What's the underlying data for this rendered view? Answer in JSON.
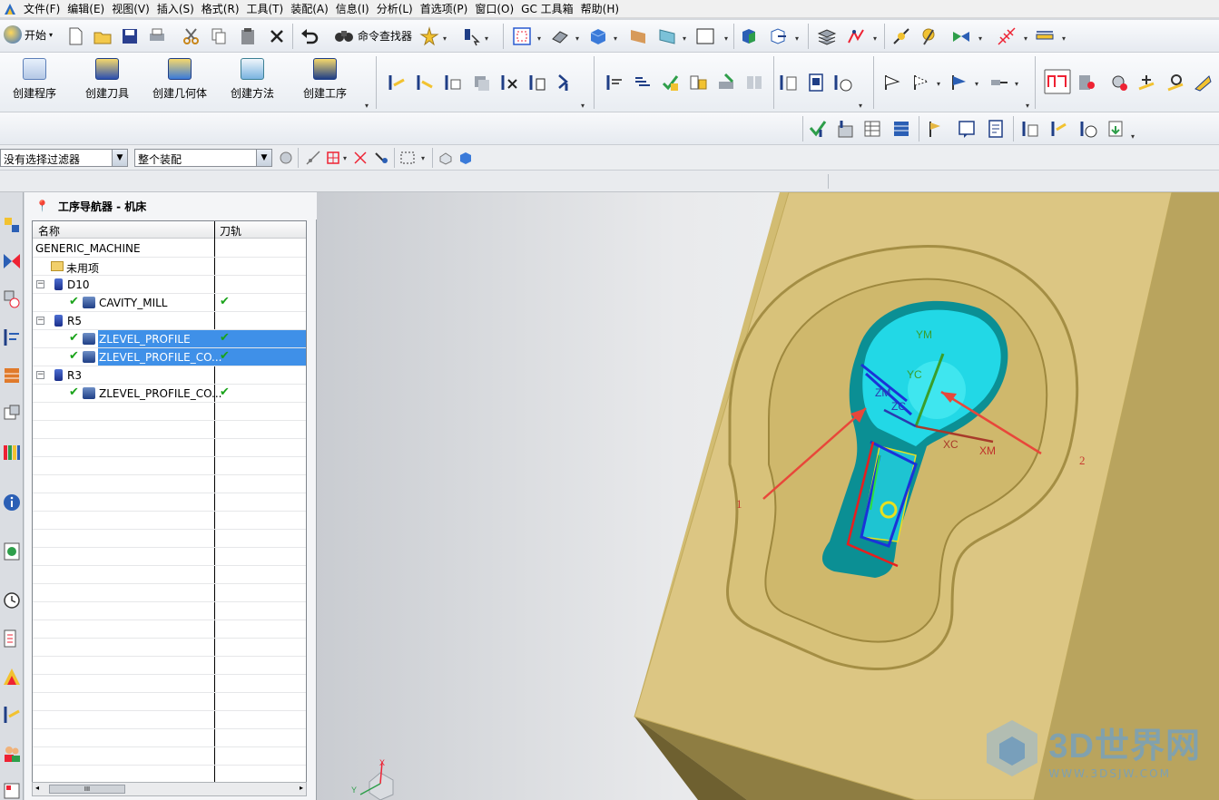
{
  "menu": {
    "items": [
      "文件(F)",
      "编辑(E)",
      "视图(V)",
      "插入(S)",
      "格式(R)",
      "工具(T)",
      "装配(A)",
      "信息(I)",
      "分析(L)",
      "首选项(P)",
      "窗口(O)",
      "GC 工具箱",
      "帮助(H)"
    ]
  },
  "toolbar": {
    "start_label": "开始",
    "cmd_finder_label": "命令查找器",
    "create_buttons": [
      "创建程序",
      "创建刀具",
      "创建几何体",
      "创建方法",
      "创建工序"
    ]
  },
  "filters": {
    "selection_filter": "没有选择过滤器",
    "assembly_scope": "整个装配"
  },
  "navigator": {
    "title": "工序导航器 - 机床",
    "col_name": "名称",
    "col_path": "刀轨",
    "rows": [
      {
        "label": "GENERIC_MACHINE",
        "type": "root",
        "status": ""
      },
      {
        "label": "未用项",
        "type": "folder",
        "status": ""
      },
      {
        "label": "D10",
        "type": "tool",
        "status": ""
      },
      {
        "label": "CAVITY_MILL",
        "type": "op",
        "status": "✔"
      },
      {
        "label": "R5",
        "type": "tool",
        "status": ""
      },
      {
        "label": "ZLEVEL_PROFILE",
        "type": "op",
        "status": "✔",
        "selected": true
      },
      {
        "label": "ZLEVEL_PROFILE_CO...",
        "type": "op",
        "status": "✔",
        "selected": true
      },
      {
        "label": "R3",
        "type": "tool",
        "status": ""
      },
      {
        "label": "ZLEVEL_PROFILE_CO...",
        "type": "op",
        "status": "✔"
      }
    ],
    "scroll_label": "III"
  },
  "viewport": {
    "axis_labels": {
      "ym": "YM",
      "yc": "YC",
      "zm": "ZM",
      "zc": "ZC",
      "xc": "XC",
      "xm": "XM"
    },
    "annotations": [
      "1",
      "2"
    ],
    "triad_labels": {
      "x": "X",
      "y": "Y"
    }
  },
  "watermark": {
    "brand": "3D世界网",
    "url": "WWW.3DSJW.COM"
  },
  "colors": {
    "selection": "#3f90e8",
    "part_tan": "#d8c27a",
    "cavity_cyan": "#22d8e6",
    "arrow_red": "#e8473a"
  }
}
